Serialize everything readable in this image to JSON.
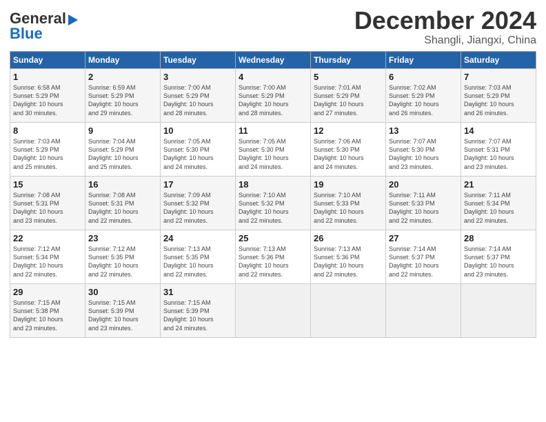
{
  "header": {
    "logo_general": "General",
    "logo_blue": "Blue",
    "month": "December 2024",
    "location": "Shangli, Jiangxi, China"
  },
  "weekdays": [
    "Sunday",
    "Monday",
    "Tuesday",
    "Wednesday",
    "Thursday",
    "Friday",
    "Saturday"
  ],
  "weeks": [
    [
      {
        "day": "1",
        "info": "Sunrise: 6:58 AM\nSunset: 5:29 PM\nDaylight: 10 hours\nand 30 minutes."
      },
      {
        "day": "2",
        "info": "Sunrise: 6:59 AM\nSunset: 5:29 PM\nDaylight: 10 hours\nand 29 minutes."
      },
      {
        "day": "3",
        "info": "Sunrise: 7:00 AM\nSunset: 5:29 PM\nDaylight: 10 hours\nand 28 minutes."
      },
      {
        "day": "4",
        "info": "Sunrise: 7:00 AM\nSunset: 5:29 PM\nDaylight: 10 hours\nand 28 minutes."
      },
      {
        "day": "5",
        "info": "Sunrise: 7:01 AM\nSunset: 5:29 PM\nDaylight: 10 hours\nand 27 minutes."
      },
      {
        "day": "6",
        "info": "Sunrise: 7:02 AM\nSunset: 5:29 PM\nDaylight: 10 hours\nand 26 minutes."
      },
      {
        "day": "7",
        "info": "Sunrise: 7:03 AM\nSunset: 5:29 PM\nDaylight: 10 hours\nand 26 minutes."
      }
    ],
    [
      {
        "day": "8",
        "info": "Sunrise: 7:03 AM\nSunset: 5:29 PM\nDaylight: 10 hours\nand 25 minutes."
      },
      {
        "day": "9",
        "info": "Sunrise: 7:04 AM\nSunset: 5:29 PM\nDaylight: 10 hours\nand 25 minutes."
      },
      {
        "day": "10",
        "info": "Sunrise: 7:05 AM\nSunset: 5:30 PM\nDaylight: 10 hours\nand 24 minutes."
      },
      {
        "day": "11",
        "info": "Sunrise: 7:05 AM\nSunset: 5:30 PM\nDaylight: 10 hours\nand 24 minutes."
      },
      {
        "day": "12",
        "info": "Sunrise: 7:06 AM\nSunset: 5:30 PM\nDaylight: 10 hours\nand 24 minutes."
      },
      {
        "day": "13",
        "info": "Sunrise: 7:07 AM\nSunset: 5:30 PM\nDaylight: 10 hours\nand 23 minutes."
      },
      {
        "day": "14",
        "info": "Sunrise: 7:07 AM\nSunset: 5:31 PM\nDaylight: 10 hours\nand 23 minutes."
      }
    ],
    [
      {
        "day": "15",
        "info": "Sunrise: 7:08 AM\nSunset: 5:31 PM\nDaylight: 10 hours\nand 23 minutes."
      },
      {
        "day": "16",
        "info": "Sunrise: 7:08 AM\nSunset: 5:31 PM\nDaylight: 10 hours\nand 22 minutes."
      },
      {
        "day": "17",
        "info": "Sunrise: 7:09 AM\nSunset: 5:32 PM\nDaylight: 10 hours\nand 22 minutes."
      },
      {
        "day": "18",
        "info": "Sunrise: 7:10 AM\nSunset: 5:32 PM\nDaylight: 10 hours\nand 22 minutes."
      },
      {
        "day": "19",
        "info": "Sunrise: 7:10 AM\nSunset: 5:33 PM\nDaylight: 10 hours\nand 22 minutes."
      },
      {
        "day": "20",
        "info": "Sunrise: 7:11 AM\nSunset: 5:33 PM\nDaylight: 10 hours\nand 22 minutes."
      },
      {
        "day": "21",
        "info": "Sunrise: 7:11 AM\nSunset: 5:34 PM\nDaylight: 10 hours\nand 22 minutes."
      }
    ],
    [
      {
        "day": "22",
        "info": "Sunrise: 7:12 AM\nSunset: 5:34 PM\nDaylight: 10 hours\nand 22 minutes."
      },
      {
        "day": "23",
        "info": "Sunrise: 7:12 AM\nSunset: 5:35 PM\nDaylight: 10 hours\nand 22 minutes."
      },
      {
        "day": "24",
        "info": "Sunrise: 7:13 AM\nSunset: 5:35 PM\nDaylight: 10 hours\nand 22 minutes."
      },
      {
        "day": "25",
        "info": "Sunrise: 7:13 AM\nSunset: 5:36 PM\nDaylight: 10 hours\nand 22 minutes."
      },
      {
        "day": "26",
        "info": "Sunrise: 7:13 AM\nSunset: 5:36 PM\nDaylight: 10 hours\nand 22 minutes."
      },
      {
        "day": "27",
        "info": "Sunrise: 7:14 AM\nSunset: 5:37 PM\nDaylight: 10 hours\nand 22 minutes."
      },
      {
        "day": "28",
        "info": "Sunrise: 7:14 AM\nSunset: 5:37 PM\nDaylight: 10 hours\nand 23 minutes."
      }
    ],
    [
      {
        "day": "29",
        "info": "Sunrise: 7:15 AM\nSunset: 5:38 PM\nDaylight: 10 hours\nand 23 minutes."
      },
      {
        "day": "30",
        "info": "Sunrise: 7:15 AM\nSunset: 5:39 PM\nDaylight: 10 hours\nand 23 minutes."
      },
      {
        "day": "31",
        "info": "Sunrise: 7:15 AM\nSunset: 5:39 PM\nDaylight: 10 hours\nand 24 minutes."
      },
      {
        "day": "",
        "info": ""
      },
      {
        "day": "",
        "info": ""
      },
      {
        "day": "",
        "info": ""
      },
      {
        "day": "",
        "info": ""
      }
    ]
  ]
}
